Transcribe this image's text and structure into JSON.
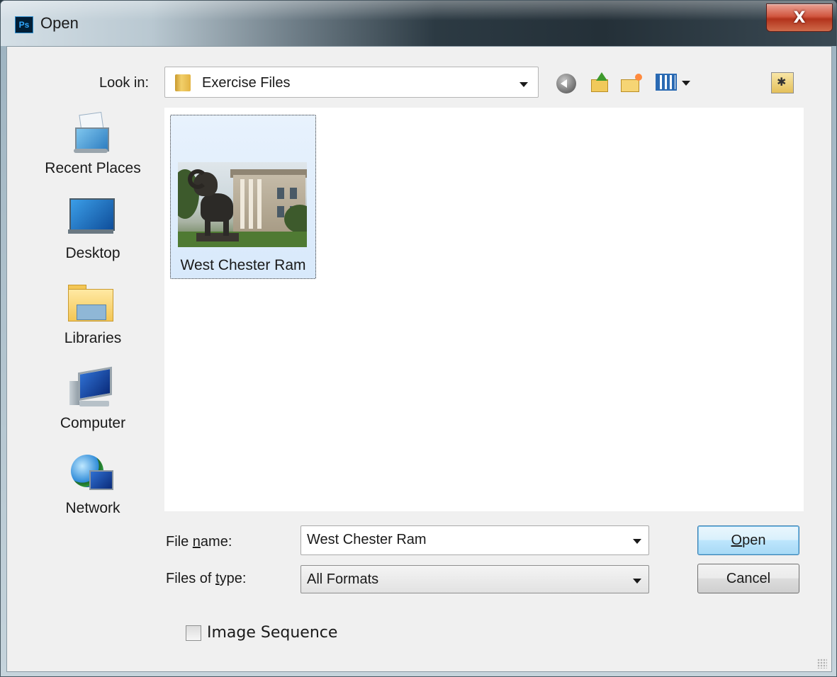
{
  "window": {
    "title": "Open",
    "app_icon_text": "Ps",
    "close_glyph": "X"
  },
  "look_in": {
    "label": "Look in:",
    "value": "Exercise Files"
  },
  "toolbar": {
    "icons": [
      "back-icon",
      "up-one-level-icon",
      "new-folder-icon",
      "views-menu-icon",
      "desktop-shortcut-icon"
    ]
  },
  "places": [
    {
      "label": "Recent Places",
      "icon": "recent-places-icon"
    },
    {
      "label": "Desktop",
      "icon": "desktop-icon"
    },
    {
      "label": "Libraries",
      "icon": "libraries-icon"
    },
    {
      "label": "Computer",
      "icon": "computer-icon"
    },
    {
      "label": "Network",
      "icon": "network-icon"
    }
  ],
  "files": [
    {
      "name": "West Chester Ram",
      "selected": true
    }
  ],
  "file_name": {
    "label_pre": "File ",
    "label_ul": "n",
    "label_post": "ame:",
    "value": "West Chester Ram"
  },
  "file_type": {
    "label_pre": "Files of ",
    "label_ul": "t",
    "label_post": "ype:",
    "value": "All Formats"
  },
  "buttons": {
    "open_ul": "O",
    "open_rest": "pen",
    "cancel": "Cancel"
  },
  "image_sequence": {
    "label": "Image Sequence",
    "checked": false
  },
  "colors": {
    "selection": "#d8e9fb",
    "default_button": "#bee6fd",
    "close_button": "#c7432a"
  }
}
